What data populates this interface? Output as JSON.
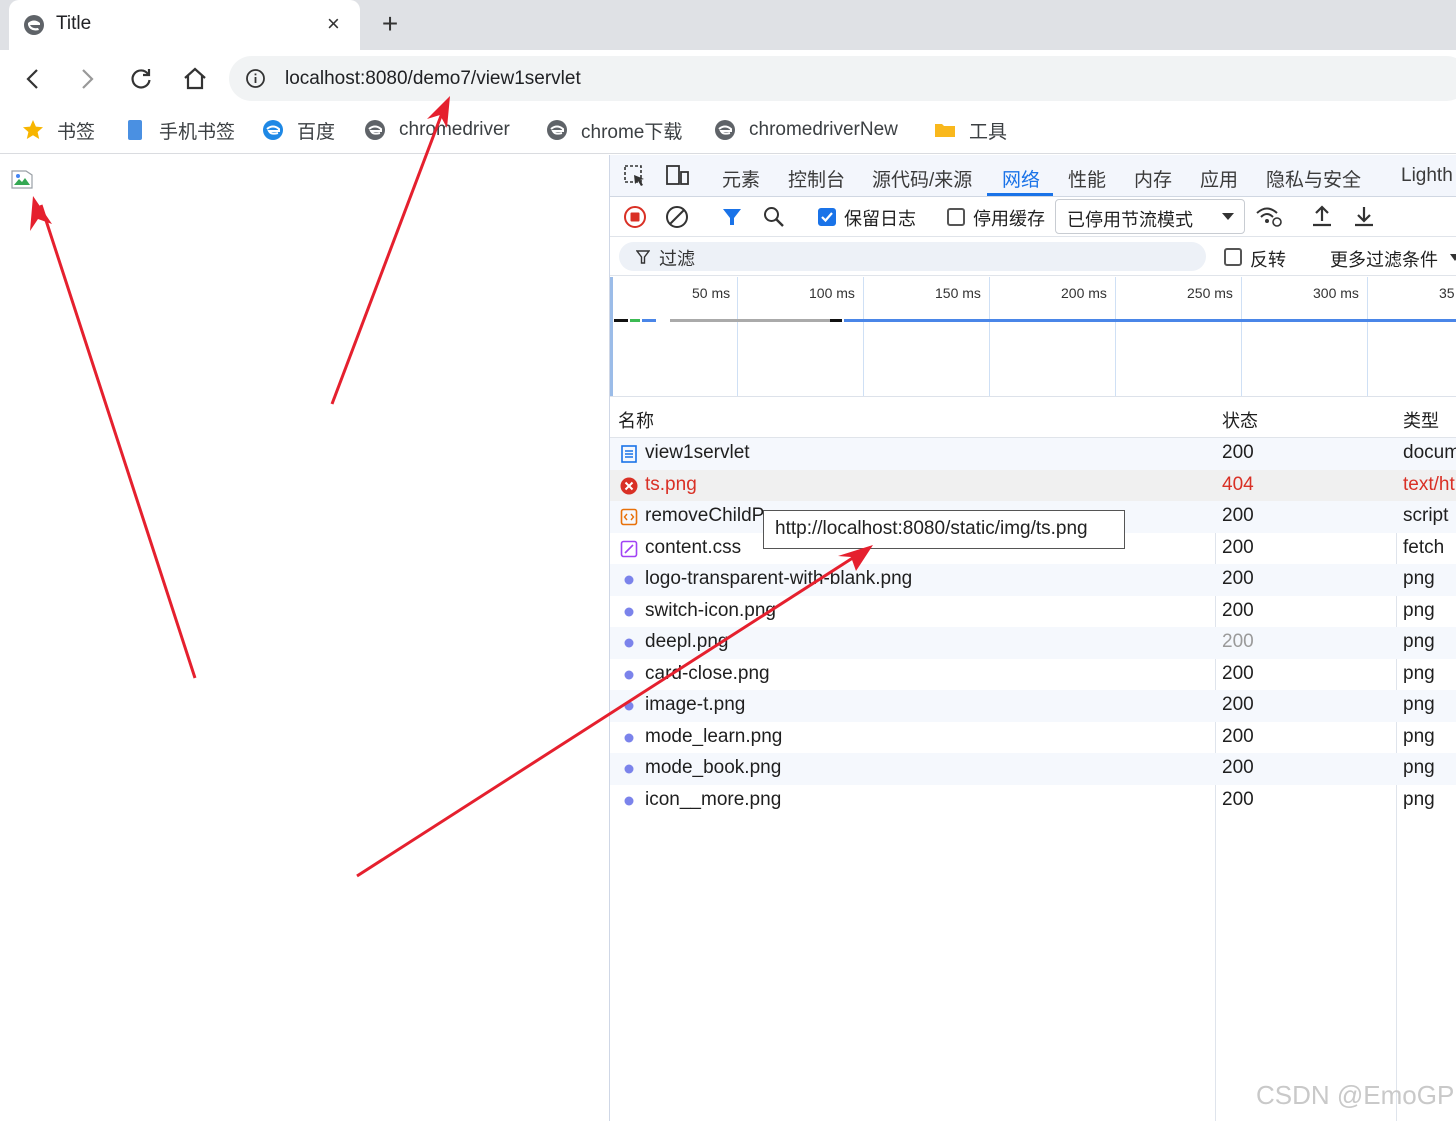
{
  "browser": {
    "tab_title": "Title",
    "tab_close": "×",
    "new_tab": "+",
    "url": "localhost:8080/demo7/view1servlet"
  },
  "bookmarks": [
    {
      "label": "书签",
      "icon": "star-icon"
    },
    {
      "label": "手机书签",
      "icon": "phone-icon"
    },
    {
      "label": "百度",
      "icon": "baidu-icon"
    },
    {
      "label": "chromedriver",
      "icon": "browser-icon"
    },
    {
      "label": "chrome下载",
      "icon": "browser-icon"
    },
    {
      "label": "chromedriverNew",
      "icon": "browser-icon"
    },
    {
      "label": "工具",
      "icon": "folder-icon"
    }
  ],
  "devtools": {
    "tabs": [
      "元素",
      "控制台",
      "源代码/来源",
      "网络",
      "性能",
      "内存",
      "应用",
      "隐私与安全",
      "Lighth"
    ],
    "active_tab": "网络",
    "preserve_log": "保留日志",
    "disable_cache": "停用缓存",
    "throttle": "已停用节流模式",
    "filter_placeholder": "过滤",
    "invert": "反转",
    "more_filters": "更多过滤条件",
    "timeline_ticks": [
      "50 ms",
      "100 ms",
      "150 ms",
      "200 ms",
      "250 ms",
      "300 ms",
      "35"
    ],
    "columns": {
      "name": "名称",
      "status": "状态",
      "type": "类型"
    },
    "rows": [
      {
        "name": "view1servlet",
        "status": "200",
        "type": "docum",
        "icon": "document-icon"
      },
      {
        "name": "ts.png",
        "status": "404",
        "type": "text/ht",
        "icon": "error-icon"
      },
      {
        "name": "removeChildP",
        "status": "200",
        "type": "script",
        "icon": "script-icon"
      },
      {
        "name": "content.css",
        "status": "200",
        "type": "fetch",
        "icon": "stylesheet-icon"
      },
      {
        "name": "logo-transparent-with-blank.png",
        "status": "200",
        "type": "png",
        "icon": "image-icon"
      },
      {
        "name": "switch-icon.png",
        "status": "200",
        "type": "png",
        "icon": "image-icon"
      },
      {
        "name": "deepl.png",
        "status": "200",
        "type": "png",
        "icon": "image-icon"
      },
      {
        "name": "card-close.png",
        "status": "200",
        "type": "png",
        "icon": "image-icon"
      },
      {
        "name": "image-t.png",
        "status": "200",
        "type": "png",
        "icon": "image-icon"
      },
      {
        "name": "mode_learn.png",
        "status": "200",
        "type": "png",
        "icon": "image-icon"
      },
      {
        "name": "mode_book.png",
        "status": "200",
        "type": "png",
        "icon": "image-icon"
      },
      {
        "name": "icon__more.png",
        "status": "200",
        "type": "png",
        "icon": "image-icon"
      }
    ],
    "tooltip": "http://localhost:8080/static/img/ts.png"
  },
  "watermark": "CSDN @EmoGP",
  "colors": {
    "accent": "#1a73e8",
    "error": "#d93025",
    "arrow": "#e5202e"
  }
}
